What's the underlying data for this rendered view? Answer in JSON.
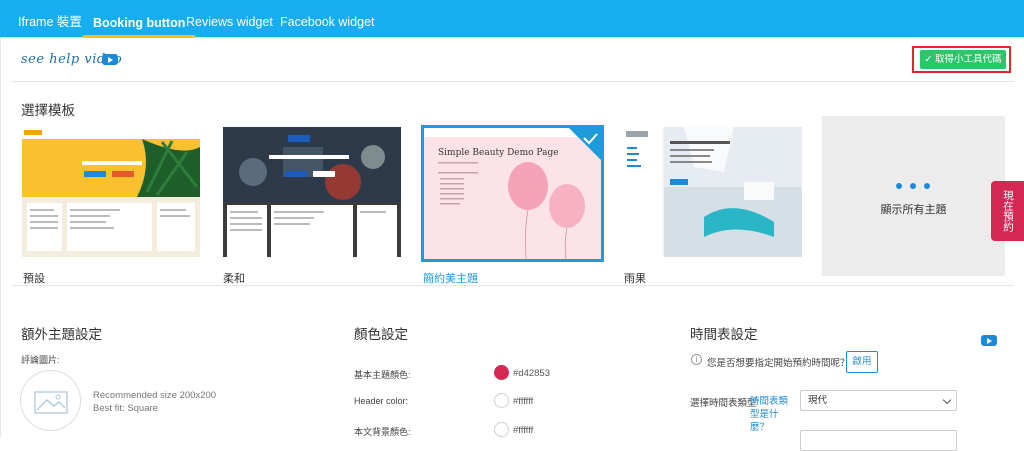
{
  "tabs": [
    {
      "label": "Iframe 裝置",
      "active": false
    },
    {
      "label": "Booking button",
      "active": true
    },
    {
      "label": "Reviews widget",
      "active": false
    },
    {
      "label": "Facebook widget",
      "active": false
    }
  ],
  "header": {
    "help_video_label": "see help video",
    "get_code_label": "✓ 取得小工具代碼"
  },
  "templates": {
    "section_title": "選擇模板",
    "items": [
      {
        "label": "預設",
        "selected": false
      },
      {
        "label": "柔和",
        "selected": false
      },
      {
        "label": "簡約美主題",
        "selected": true,
        "preview_title": "Simple Beauty Demo Page"
      },
      {
        "label": "雨果",
        "selected": false
      }
    ],
    "show_all_label": "顯示所有主題"
  },
  "book_now_label": "現在預約",
  "extra_theme": {
    "section_title": "額外主題設定",
    "review_image_label": "評論圖片:",
    "recommended_size": "Recommended size 200x200",
    "best_fit": "Best fit: Square"
  },
  "colors": {
    "section_title": "顏色設定",
    "rows": [
      {
        "label": "基本主題顏色:",
        "value": "#d42853"
      },
      {
        "label": "Header color:",
        "value": "#ffffff"
      },
      {
        "label": "本文背景顏色:",
        "value": "#ffffff"
      }
    ]
  },
  "timeline": {
    "section_title": "時間表設定",
    "question": "您是否想要指定開始預約時間呢？",
    "enable_label": "啟用",
    "type_label": "選擇時間表類型",
    "type_link": "時間表類型是什麼？",
    "type_value": "現代"
  },
  "accent": "#16aef0"
}
